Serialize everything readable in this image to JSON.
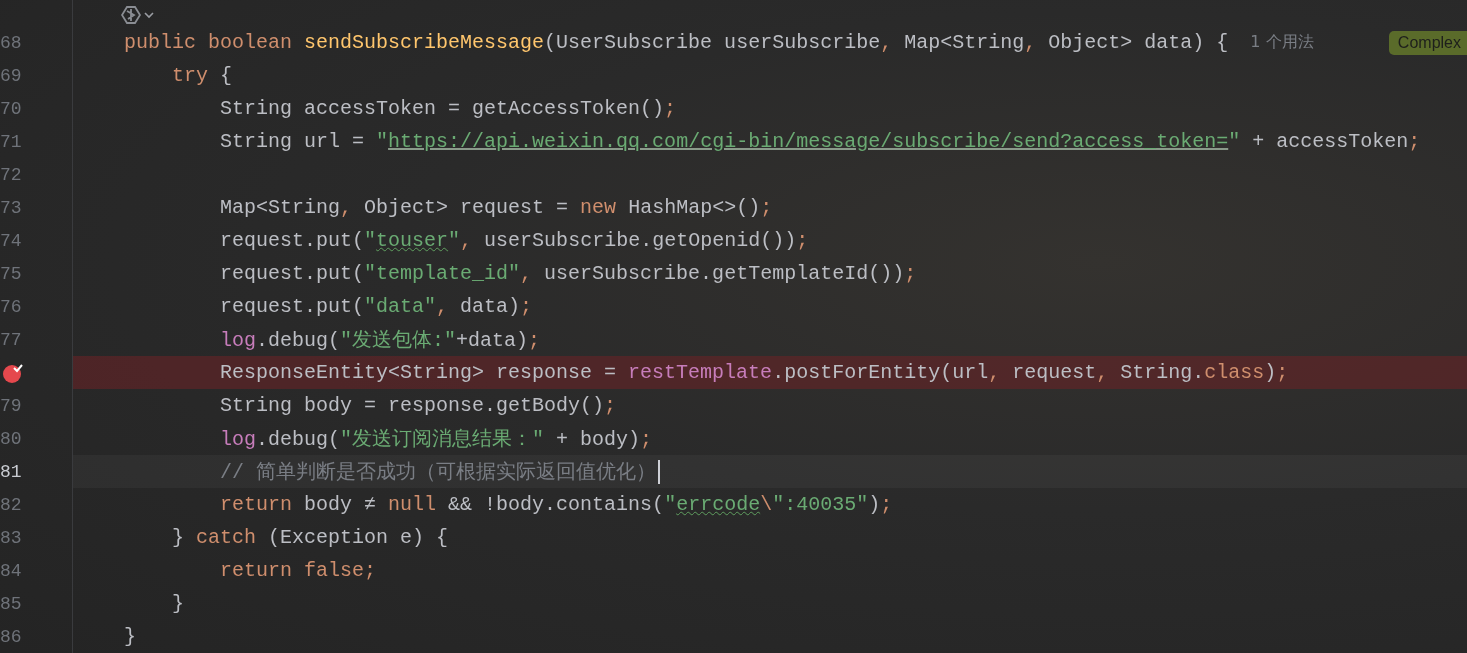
{
  "editor": {
    "lines": [
      {
        "number": "68",
        "breakpoint": false,
        "current": false,
        "caret": false,
        "hint": "1 个用法",
        "badge": "Complex",
        "tokens": [
          {
            "kind": "kw",
            "text": "    public boolean "
          },
          {
            "kind": "fn",
            "text": "sendSubscribeMessage"
          },
          {
            "kind": "plain",
            "text": "(UserSubscribe userSubscribe"
          },
          {
            "kind": "kw",
            "text": ","
          },
          {
            "kind": "plain",
            "text": " Map<String"
          },
          {
            "kind": "kw",
            "text": ","
          },
          {
            "kind": "plain",
            "text": " Object> data) {"
          }
        ]
      },
      {
        "number": "69",
        "breakpoint": false,
        "current": false,
        "caret": false,
        "tokens": [
          {
            "kind": "kw",
            "text": "        try"
          },
          {
            "kind": "plain",
            "text": " {"
          }
        ]
      },
      {
        "number": "70",
        "breakpoint": false,
        "current": false,
        "caret": false,
        "tokens": [
          {
            "kind": "plain",
            "text": "            String accessToken = getAccessToken()"
          },
          {
            "kind": "kw",
            "text": ";"
          }
        ]
      },
      {
        "number": "71",
        "breakpoint": false,
        "current": false,
        "caret": false,
        "tokens": [
          {
            "kind": "plain",
            "text": "            String url = "
          },
          {
            "kind": "str",
            "text": "\""
          },
          {
            "kind": "link",
            "text": "https://api.weixin.qq.com/cgi-bin/message/subscribe/send?access_token="
          },
          {
            "kind": "str",
            "text": "\""
          },
          {
            "kind": "plain",
            "text": " + accessToken"
          },
          {
            "kind": "kw",
            "text": ";"
          }
        ]
      },
      {
        "number": "72",
        "breakpoint": false,
        "current": false,
        "caret": false
      },
      {
        "number": "73",
        "breakpoint": false,
        "current": false,
        "caret": false,
        "tokens": [
          {
            "kind": "plain",
            "text": "            Map<String"
          },
          {
            "kind": "kw",
            "text": ","
          },
          {
            "kind": "plain",
            "text": " Object> request = "
          },
          {
            "kind": "kw",
            "text": "new"
          },
          {
            "kind": "plain",
            "text": " HashMap<>()"
          },
          {
            "kind": "kw",
            "text": ";"
          }
        ]
      },
      {
        "number": "74",
        "breakpoint": false,
        "current": false,
        "caret": false,
        "tokens": [
          {
            "kind": "plain",
            "text": "            request.put("
          },
          {
            "kind": "str",
            "text": "\""
          },
          {
            "kind": "squiggle",
            "text": "touser"
          },
          {
            "kind": "str",
            "text": "\""
          },
          {
            "kind": "kw",
            "text": ","
          },
          {
            "kind": "plain",
            "text": " userSubscribe.getOpenid())"
          },
          {
            "kind": "kw",
            "text": ";"
          }
        ]
      },
      {
        "number": "75",
        "breakpoint": false,
        "current": false,
        "caret": false,
        "tokens": [
          {
            "kind": "plain",
            "text": "            request.put("
          },
          {
            "kind": "str",
            "text": "\"template_id\""
          },
          {
            "kind": "kw",
            "text": ","
          },
          {
            "kind": "plain",
            "text": " userSubscribe.getTemplateId())"
          },
          {
            "kind": "kw",
            "text": ";"
          }
        ]
      },
      {
        "number": "76",
        "breakpoint": false,
        "current": false,
        "caret": false,
        "tokens": [
          {
            "kind": "plain",
            "text": "            request.put("
          },
          {
            "kind": "str",
            "text": "\"data\""
          },
          {
            "kind": "kw",
            "text": ","
          },
          {
            "kind": "plain",
            "text": " data)"
          },
          {
            "kind": "kw",
            "text": ";"
          }
        ]
      },
      {
        "number": "77",
        "breakpoint": false,
        "current": false,
        "caret": false,
        "tokens": [
          {
            "kind": "field",
            "text": "            log"
          },
          {
            "kind": "plain",
            "text": ".debug("
          },
          {
            "kind": "str",
            "text": "\"发送包体:\""
          },
          {
            "kind": "plain",
            "text": "+data)"
          },
          {
            "kind": "kw",
            "text": ";"
          }
        ]
      },
      {
        "breakpoint": true,
        "current": false,
        "caret": false,
        "tokens": [
          {
            "kind": "plain",
            "text": "            ResponseEntity<String> response = "
          },
          {
            "kind": "field",
            "text": "restTemplate"
          },
          {
            "kind": "plain",
            "text": ".postForEntity(url"
          },
          {
            "kind": "kw",
            "text": ","
          },
          {
            "kind": "plain",
            "text": " request"
          },
          {
            "kind": "kw",
            "text": ","
          },
          {
            "kind": "plain",
            "text": " String."
          },
          {
            "kind": "kw",
            "text": "class"
          },
          {
            "kind": "plain",
            "text": ")"
          },
          {
            "kind": "kw",
            "text": ";"
          }
        ]
      },
      {
        "number": "79",
        "breakpoint": false,
        "current": false,
        "caret": false,
        "tokens": [
          {
            "kind": "plain",
            "text": "            String body = response.getBody()"
          },
          {
            "kind": "kw",
            "text": ";"
          }
        ]
      },
      {
        "number": "80",
        "breakpoint": false,
        "current": false,
        "caret": false,
        "tokens": [
          {
            "kind": "field",
            "text": "            log"
          },
          {
            "kind": "plain",
            "text": ".debug("
          },
          {
            "kind": "str",
            "text": "\"发送订阅消息结果：\""
          },
          {
            "kind": "plain",
            "text": " + body)"
          },
          {
            "kind": "kw",
            "text": ";"
          }
        ]
      },
      {
        "number": "81",
        "breakpoint": false,
        "current": true,
        "caret": true,
        "tokens": [
          {
            "kind": "comment",
            "text": "            // 简单判断是否成功（可根据实际返回值优化）"
          }
        ]
      },
      {
        "number": "82",
        "breakpoint": false,
        "current": false,
        "caret": false,
        "tokens": [
          {
            "kind": "kw",
            "text": "            return"
          },
          {
            "kind": "plain",
            "text": " body ≠ "
          },
          {
            "kind": "kw",
            "text": "null"
          },
          {
            "kind": "plain",
            "text": " && !body.contains("
          },
          {
            "kind": "str",
            "text": "\""
          },
          {
            "kind": "squiggle",
            "text": "errcode"
          },
          {
            "kind": "kw",
            "text": "\\"
          },
          {
            "kind": "str",
            "text": "\":40035\""
          },
          {
            "kind": "plain",
            "text": ")"
          },
          {
            "kind": "kw",
            "text": ";"
          }
        ]
      },
      {
        "number": "83",
        "breakpoint": false,
        "current": false,
        "caret": false,
        "tokens": [
          {
            "kind": "plain",
            "text": "        } "
          },
          {
            "kind": "kw",
            "text": "catch"
          },
          {
            "kind": "plain",
            "text": " (Exception e) {"
          }
        ]
      },
      {
        "number": "84",
        "breakpoint": false,
        "current": false,
        "caret": false,
        "tokens": [
          {
            "kind": "kw",
            "text": "            return false;"
          }
        ]
      },
      {
        "number": "85",
        "breakpoint": false,
        "current": false,
        "caret": false,
        "tokens": [
          {
            "kind": "plain",
            "text": "        }"
          }
        ]
      },
      {
        "number": "86",
        "breakpoint": false,
        "current": false,
        "caret": false,
        "tokens": [
          {
            "kind": "plain",
            "text": "    }"
          }
        ]
      }
    ]
  }
}
